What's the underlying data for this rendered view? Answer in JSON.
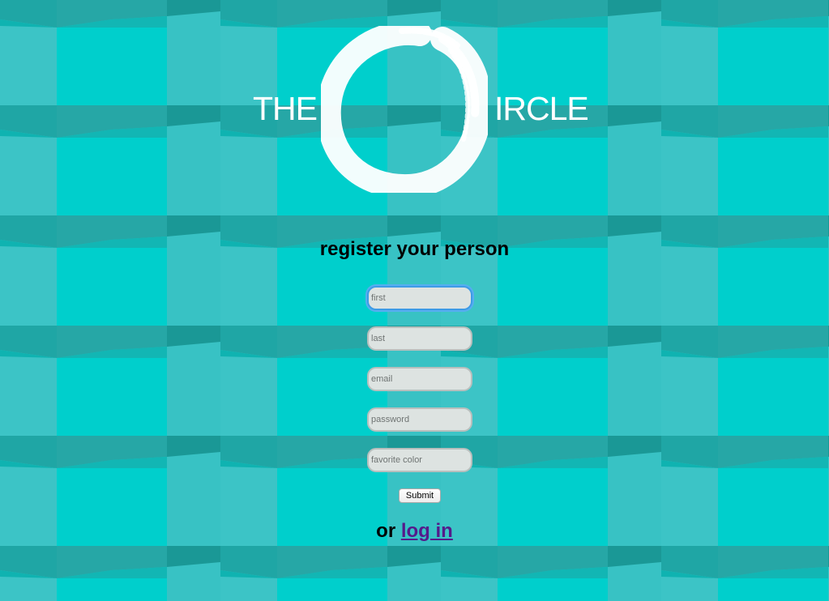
{
  "logo": {
    "word_left": "THE",
    "word_right": "IRCLE",
    "enso_icon": "enso-circle-brush",
    "color": "#ffffff"
  },
  "register": {
    "heading": "register your person",
    "fields": {
      "first": {
        "placeholder": "first",
        "value": ""
      },
      "last": {
        "placeholder": "last",
        "value": ""
      },
      "email": {
        "placeholder": "email",
        "value": ""
      },
      "password": {
        "placeholder": "password",
        "value": ""
      },
      "favorite_color": {
        "placeholder": "favorite color",
        "value": ""
      }
    },
    "submit_label": "Submit"
  },
  "login": {
    "prefix": "or",
    "link_label": "log in"
  },
  "colors": {
    "background_base": "#00ccc9",
    "background_light": "#3cc3c5",
    "background_dark": "#1a9d9b",
    "focus_ring": "#3d9be6",
    "link": "#551a8b"
  }
}
